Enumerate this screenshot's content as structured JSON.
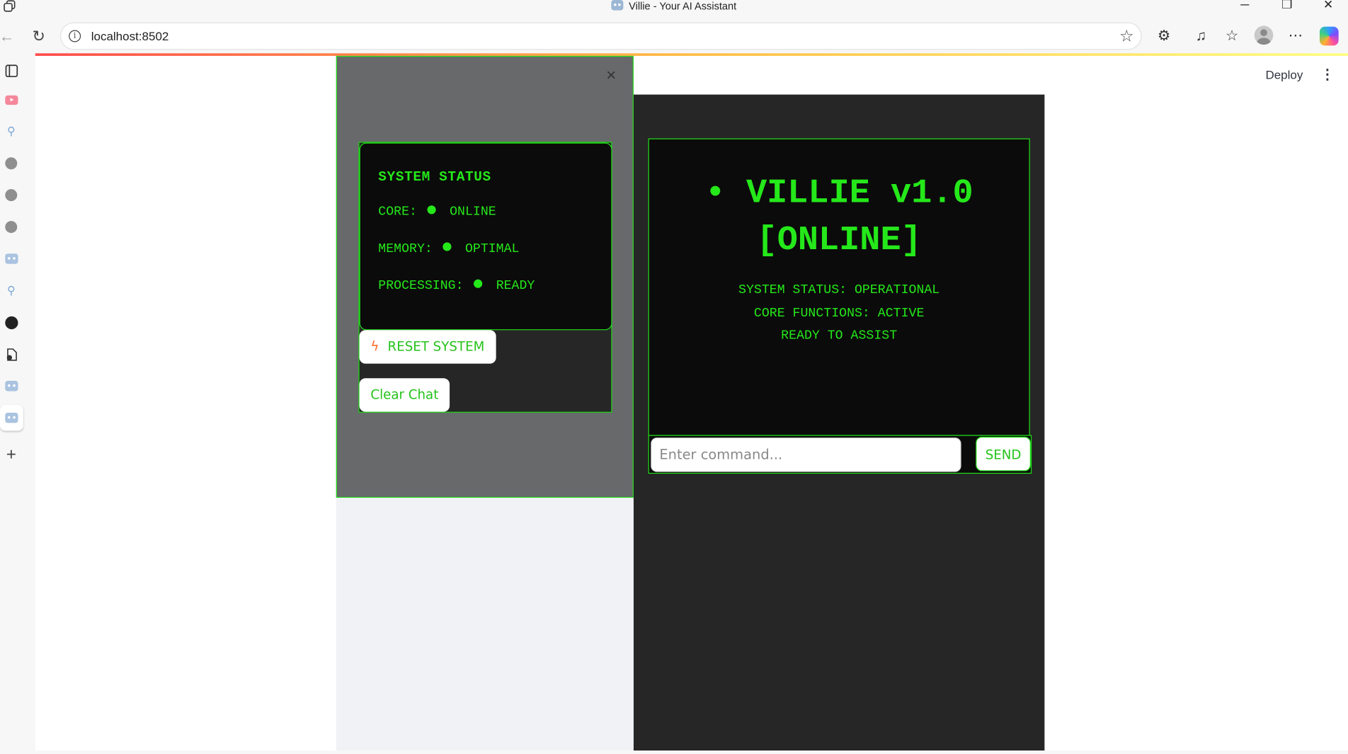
{
  "window": {
    "title": "Villie - Your AI Assistant",
    "minimize": "─",
    "restore": "❐",
    "close": "✕"
  },
  "browser": {
    "url": "localhost:8502",
    "icons": [
      "back-icon",
      "refresh-icon",
      "info-icon",
      "favorite-star-icon",
      "extensions-icon",
      "media-icon",
      "favorites-icon",
      "profile-icon",
      "more-icon",
      "copilot-icon"
    ]
  },
  "app_header": {
    "deploy_label": "Deploy",
    "menu_glyph": "⋮"
  },
  "sidebar": {
    "close_glyph": "×",
    "status": {
      "title": "SYSTEM STATUS",
      "rows": [
        {
          "label": "CORE:",
          "value": "ONLINE"
        },
        {
          "label": "MEMORY:",
          "value": "OPTIMAL"
        },
        {
          "label": "PROCESSING:",
          "value": "READY"
        }
      ]
    },
    "reset_label": "RESET SYSTEM",
    "clear_label": "Clear Chat"
  },
  "main": {
    "title_line1": "• VILLIE v1.0",
    "title_line2": "[ONLINE]",
    "status_lines": [
      "SYSTEM STATUS: OPERATIONAL",
      "CORE FUNCTIONS: ACTIVE",
      "READY TO ASSIST"
    ],
    "input_placeholder": "Enter command...",
    "send_label": "SEND"
  },
  "colors": {
    "terminal_green": "#25e81a",
    "panel_black": "#0b0b0b",
    "sidebar_gray": "#68696b",
    "main_dark": "#262626"
  }
}
